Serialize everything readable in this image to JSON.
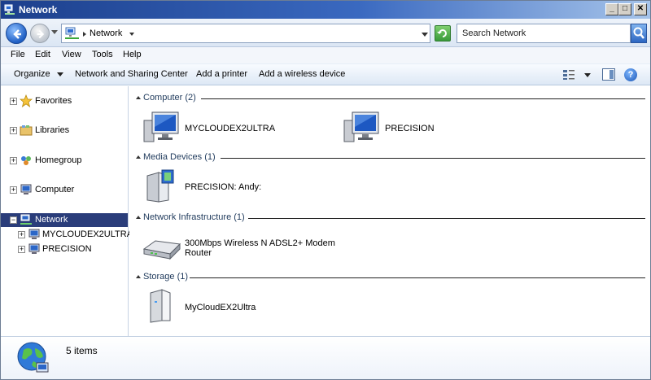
{
  "window": {
    "title": "Network",
    "minimize": "_",
    "maximize": "□",
    "close": "✕"
  },
  "address": {
    "icon": "network-icon",
    "breadcrumb": "Network",
    "search_placeholder": "Search Network"
  },
  "menubar": {
    "items": [
      "File",
      "Edit",
      "View",
      "Tools",
      "Help"
    ]
  },
  "commandbar": {
    "organize": "Organize",
    "network_sharing": "Network and Sharing Center",
    "add_printer": "Add a printer",
    "add_wireless": "Add a wireless device",
    "help": "?"
  },
  "navpane": {
    "items": [
      {
        "label": "Favorites",
        "icon": "star-icon"
      },
      {
        "label": "Libraries",
        "icon": "libraries-icon"
      },
      {
        "label": "Homegroup",
        "icon": "homegroup-icon"
      },
      {
        "label": "Computer",
        "icon": "computer-icon"
      },
      {
        "label": "Network",
        "icon": "network-icon",
        "selected": true
      },
      {
        "label": "MYCLOUDEX2ULTRA",
        "icon": "computer-icon"
      },
      {
        "label": "PRECISION",
        "icon": "computer-icon"
      }
    ]
  },
  "groups": [
    {
      "title": "Computer (2)",
      "items": [
        {
          "label": "MYCLOUDEX2ULTRA",
          "icon": "computer-icon"
        },
        {
          "label": "PRECISION",
          "icon": "computer-icon"
        }
      ]
    },
    {
      "title": "Media Devices (1)",
      "items": [
        {
          "label": "PRECISION: Andy:",
          "icon": "media-device-icon"
        }
      ]
    },
    {
      "title": "Network Infrastructure (1)",
      "items": [
        {
          "label": "300Mbps Wireless N ADSL2+ Modem",
          "label2": "Router",
          "icon": "router-icon"
        }
      ]
    },
    {
      "title": "Storage (1)",
      "items": [
        {
          "label": "MyCloudEX2Ultra",
          "icon": "storage-icon"
        }
      ]
    }
  ],
  "details": {
    "count": "5 items",
    "icon": "network-globe-icon"
  }
}
